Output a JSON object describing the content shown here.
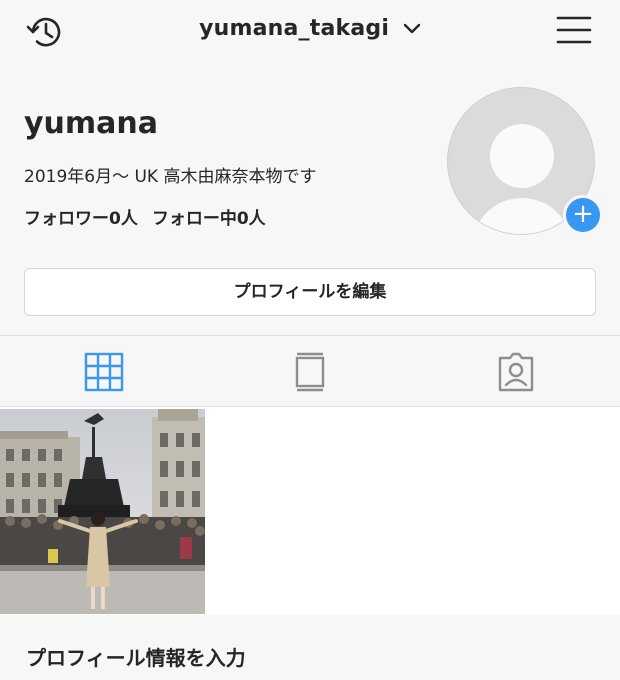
{
  "header": {
    "username": "yumana_takagi",
    "history_icon": "history-icon",
    "menu_icon": "hamburger-menu-icon"
  },
  "profile": {
    "display_name": "yumana",
    "bio": "2019年6月〜 UK 高木由麻奈本物です",
    "followers": "フォロワー0人",
    "following": "フォロー中0人",
    "edit_button": "プロフィールを編集"
  },
  "tabs": [
    {
      "name": "grid",
      "icon": "grid-icon",
      "active": true
    },
    {
      "name": "feed",
      "icon": "feed-icon",
      "active": false
    },
    {
      "name": "tagged",
      "icon": "tagged-person-icon",
      "active": false
    }
  ],
  "footer_prompt": "プロフィール情報を入力",
  "colors": {
    "accent": "#3897f0",
    "text": "#262626",
    "background": "#f7f7f7"
  }
}
